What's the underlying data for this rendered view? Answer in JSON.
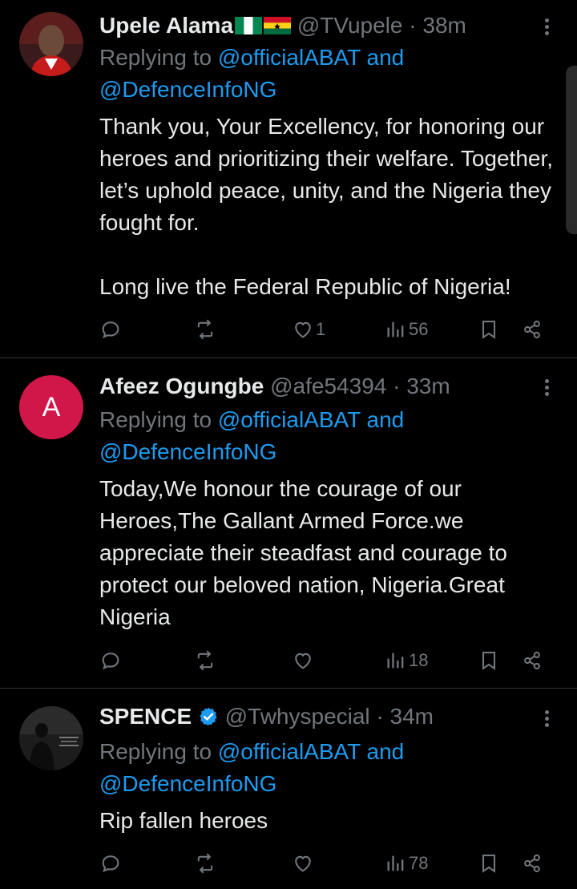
{
  "tweets": [
    {
      "name": "Upele Alama",
      "handle": "@TVupele",
      "time": "· 38m",
      "reply_prefix": "Replying to ",
      "reply_to_1": "@officialABAT",
      "reply_and": " and",
      "reply_to_2": "@DefenceInfoNG",
      "text": "Thank you, Your Excellency, for honoring our heroes and prioritizing their welfare. Together, let’s uphold peace, unity, and the Nigeria they fought for.\n\nLong live the Federal Republic of Nigeria!",
      "likes": "1",
      "views": "56"
    },
    {
      "name": "Afeez Ogungbe",
      "handle": "@afe54394",
      "time": "· 33m",
      "avatar_letter": "A",
      "reply_prefix": "Replying to ",
      "reply_to_1": "@officialABAT",
      "reply_and": " and",
      "reply_to_2": "@DefenceInfoNG",
      "text": "Today,We honour the courage of our Heroes,The Gallant Armed Force.we appreciate their steadfast and courage to protect our beloved nation, Nigeria.Great Nigeria",
      "likes": "",
      "views": "18"
    },
    {
      "name": "SPENCE",
      "handle": "@Twhyspecial",
      "time": "· 34m",
      "reply_prefix": "Replying to ",
      "reply_to_1": "@officialABAT",
      "reply_and": " and",
      "reply_to_2": "@DefenceInfoNG",
      "text": "Rip fallen heroes",
      "likes": "",
      "views": "78"
    }
  ],
  "colors": {
    "link": "#1d9bf0",
    "muted": "#71767b",
    "avatar_a": "#d1174a",
    "verified": "#1d9bf0"
  }
}
